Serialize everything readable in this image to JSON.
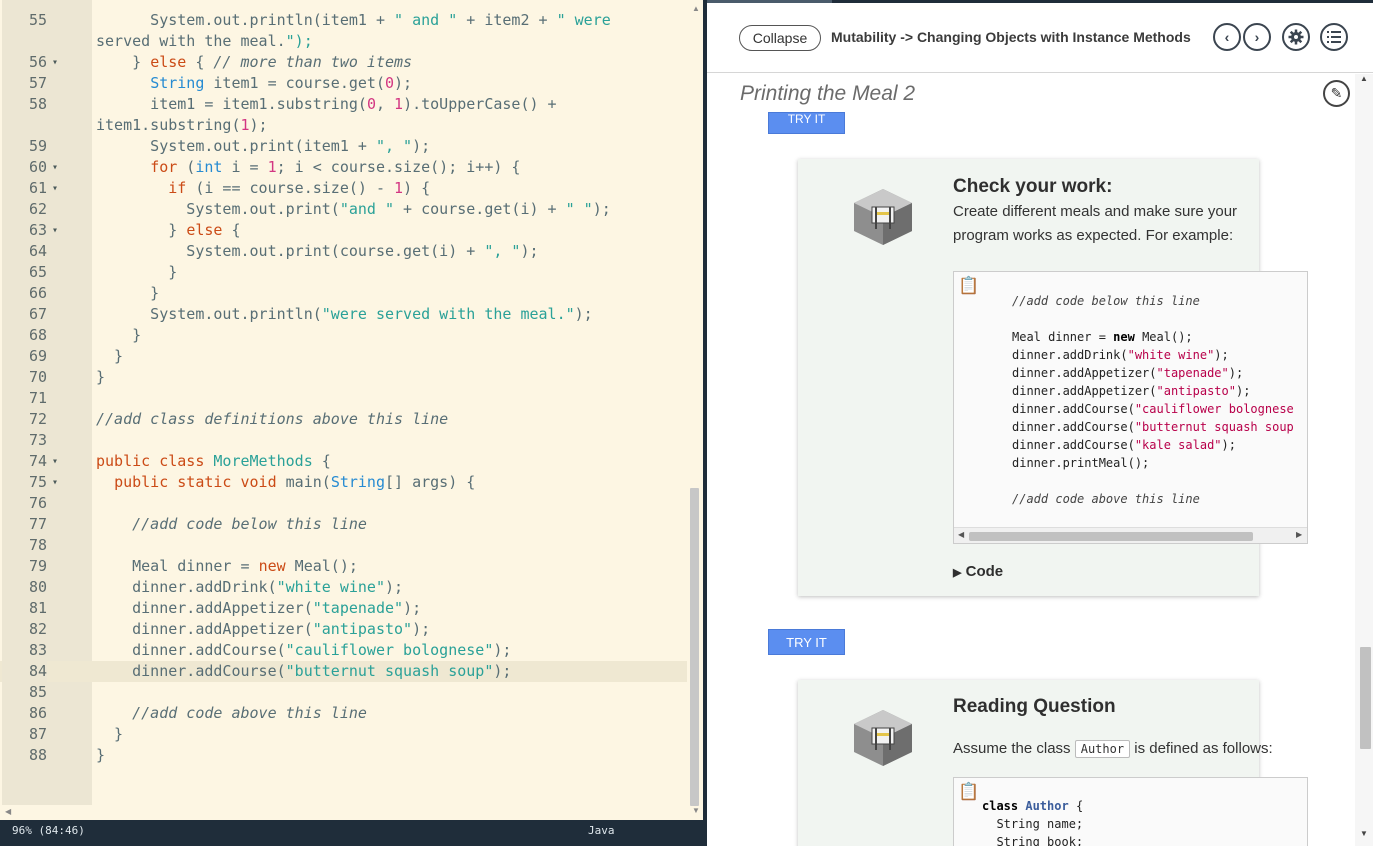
{
  "editor": {
    "status": {
      "zoom": "96%  (84:46)",
      "language": "Java"
    },
    "lines": [
      {
        "n": "55",
        "fold": "",
        "code": "      System.out.println(item1 + \" and \" + item2 + \" were"
      },
      {
        "n": "",
        "fold": "",
        "code": "served with the meal.\");"
      },
      {
        "n": "56",
        "fold": "▾",
        "code": "    } else { // more than two items"
      },
      {
        "n": "57",
        "fold": "",
        "code": "      String item1 = course.get(0);"
      },
      {
        "n": "58",
        "fold": "",
        "code": "      item1 = item1.substring(0, 1).toUpperCase() +"
      },
      {
        "n": "",
        "fold": "",
        "code": "item1.substring(1);"
      },
      {
        "n": "59",
        "fold": "",
        "code": "      System.out.print(item1 + \", \");"
      },
      {
        "n": "60",
        "fold": "▾",
        "code": "      for (int i = 1; i < course.size(); i++) {"
      },
      {
        "n": "61",
        "fold": "▾",
        "code": "        if (i == course.size() - 1) {"
      },
      {
        "n": "62",
        "fold": "",
        "code": "          System.out.print(\"and \" + course.get(i) + \" \");"
      },
      {
        "n": "63",
        "fold": "▾",
        "code": "        } else {"
      },
      {
        "n": "64",
        "fold": "",
        "code": "          System.out.print(course.get(i) + \", \");"
      },
      {
        "n": "65",
        "fold": "",
        "code": "        }"
      },
      {
        "n": "66",
        "fold": "",
        "code": "      }"
      },
      {
        "n": "67",
        "fold": "",
        "code": "      System.out.println(\"were served with the meal.\");"
      },
      {
        "n": "68",
        "fold": "",
        "code": "    }"
      },
      {
        "n": "69",
        "fold": "",
        "code": "  }"
      },
      {
        "n": "70",
        "fold": "",
        "code": "}"
      },
      {
        "n": "71",
        "fold": "",
        "code": ""
      },
      {
        "n": "72",
        "fold": "",
        "code": "//add class definitions above this line"
      },
      {
        "n": "73",
        "fold": "",
        "code": ""
      },
      {
        "n": "74",
        "fold": "▾",
        "code": "public class MoreMethods {"
      },
      {
        "n": "75",
        "fold": "▾",
        "code": "  public static void main(String[] args) {"
      },
      {
        "n": "76",
        "fold": "",
        "code": ""
      },
      {
        "n": "77",
        "fold": "",
        "code": "    //add code below this line"
      },
      {
        "n": "78",
        "fold": "",
        "code": ""
      },
      {
        "n": "79",
        "fold": "",
        "code": "    Meal dinner = new Meal();"
      },
      {
        "n": "80",
        "fold": "",
        "code": "    dinner.addDrink(\"white wine\");"
      },
      {
        "n": "81",
        "fold": "",
        "code": "    dinner.addAppetizer(\"tapenade\");"
      },
      {
        "n": "82",
        "fold": "",
        "code": "    dinner.addAppetizer(\"antipasto\");"
      },
      {
        "n": "83",
        "fold": "",
        "code": "    dinner.addCourse(\"cauliflower bolognese\");"
      },
      {
        "n": "84",
        "fold": "",
        "code": "    dinner.addCourse(\"butternut squash soup\");"
      },
      {
        "n": "85",
        "fold": "",
        "code": ""
      },
      {
        "n": "86",
        "fold": "",
        "code": "    //add code above this line"
      },
      {
        "n": "87",
        "fold": "",
        "code": "  }"
      },
      {
        "n": "88",
        "fold": "",
        "code": "}"
      }
    ],
    "active_line": "84"
  },
  "guide": {
    "header": {
      "collapse_label": "Collapse",
      "breadcrumb": "Mutability -> Changing Objects with Instance Methods",
      "icons": [
        "chevron-left-icon",
        "chevron-right-icon",
        "gear-icon",
        "list-icon"
      ]
    },
    "page_title": "Printing the Meal 2",
    "try_it_label": "TRY IT",
    "check_card": {
      "title": "Check your work:",
      "text": "Create different meals and make sure your program works as expected. For example:",
      "code_lines": [
        "//add code below this line",
        "",
        "Meal dinner = new Meal();",
        "dinner.addDrink(\"white wine\");",
        "dinner.addAppetizer(\"tapenade\");",
        "dinner.addAppetizer(\"antipasto\");",
        "dinner.addCourse(\"cauliflower bolognese",
        "dinner.addCourse(\"butternut squash soup",
        "dinner.addCourse(\"kale salad\");",
        "dinner.printMeal();",
        "",
        "//add code above this line"
      ],
      "details_label": "Code"
    },
    "reading_card": {
      "title": "Reading Question",
      "text_before": "Assume the class",
      "inline_code": "Author",
      "text_after": "is defined as follows:",
      "code_lines": [
        "class Author {",
        "  String name;",
        "  String book;"
      ]
    }
  }
}
